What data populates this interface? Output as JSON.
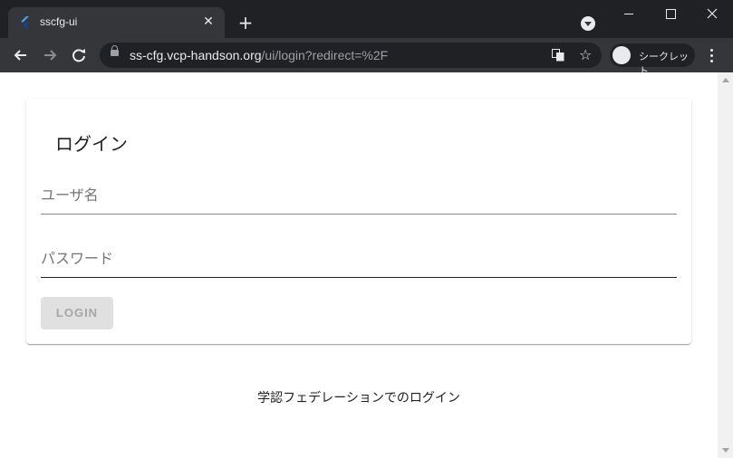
{
  "browser": {
    "tab": {
      "title": "sscfg-ui",
      "close": "✕"
    },
    "new_tab": "+",
    "address": {
      "host": "ss-cfg.vcp-handson.org",
      "path": "/ui/login?redirect=%2F"
    },
    "profile_label": "シークレット",
    "star": "☆"
  },
  "login": {
    "title": "ログイン",
    "username_placeholder": "ユーザ名",
    "password_placeholder": "パスワード",
    "button": "LOGIN",
    "federation_link": "学認フェデレーションでのログイン"
  },
  "colors": {
    "accent": "#1a73e8",
    "chrome_dark": "#202124",
    "chrome_tab": "#35363a"
  }
}
